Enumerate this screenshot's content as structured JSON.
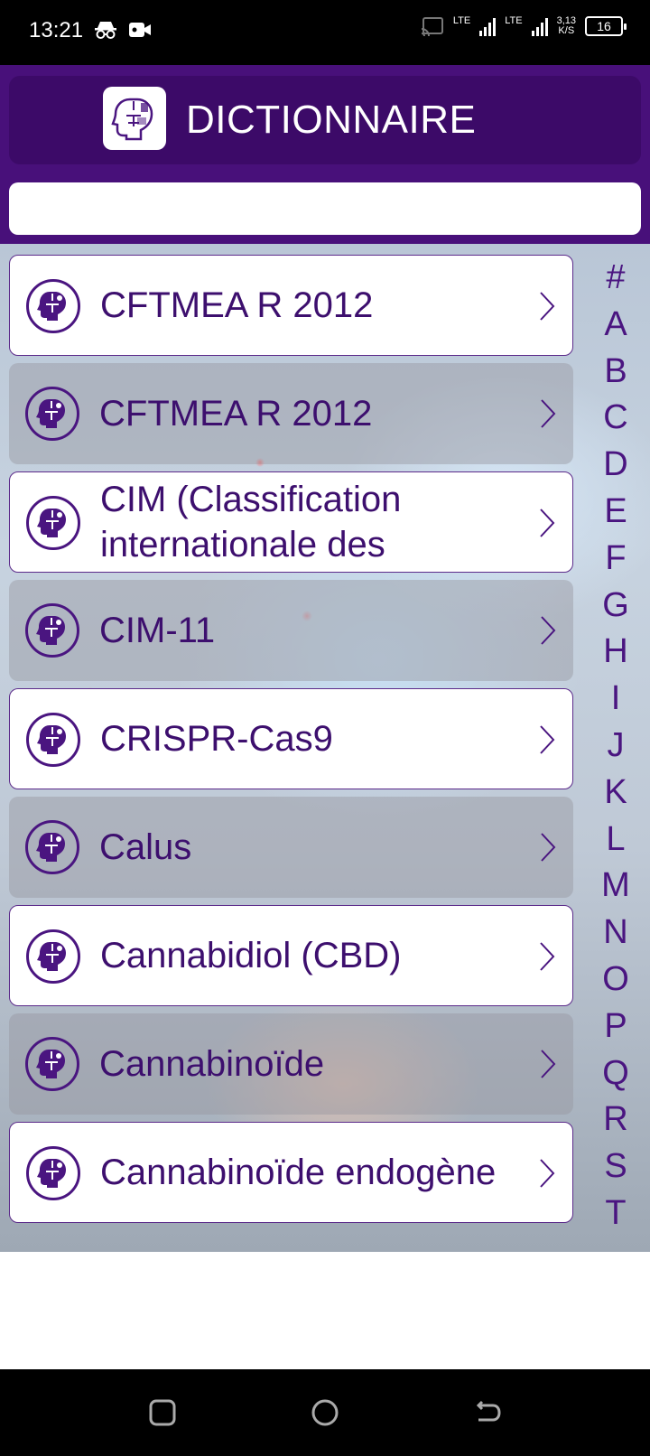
{
  "status_bar": {
    "time": "13:21",
    "network_1": "LTE",
    "network_2": "LTE",
    "speed_value": "3,13",
    "speed_unit": "K/S",
    "battery": "16"
  },
  "header": {
    "title": "DICTIONNAIRE",
    "logo_icon": "puzzle-head-icon",
    "search_placeholder": "",
    "search_value": ""
  },
  "colors": {
    "header_bg": "#48107a",
    "title_bar_bg": "#3c0a68",
    "accent_text": "#3d0f6e"
  },
  "entries": [
    {
      "label": "CFTMEA R 2012",
      "style": "light"
    },
    {
      "label": "CFTMEA R 2012",
      "style": "dark"
    },
    {
      "label": "CIM (Classification internationale des",
      "style": "light"
    },
    {
      "label": "CIM-11",
      "style": "dark"
    },
    {
      "label": "CRISPR-Cas9",
      "style": "light"
    },
    {
      "label": "Calus",
      "style": "dark"
    },
    {
      "label": "Cannabidiol (CBD)",
      "style": "light"
    },
    {
      "label": "Cannabinoïde",
      "style": "dark"
    },
    {
      "label": "Cannabinoïde endogène",
      "style": "light"
    }
  ],
  "alphabet": [
    "#",
    "A",
    "B",
    "C",
    "D",
    "E",
    "F",
    "G",
    "H",
    "I",
    "J",
    "K",
    "L",
    "M",
    "N",
    "O",
    "P",
    "Q",
    "R",
    "S",
    "T"
  ],
  "nav_bar": {
    "recents_icon": "square-recents-icon",
    "home_icon": "circle-home-icon",
    "back_icon": "back-arrow-icon"
  }
}
